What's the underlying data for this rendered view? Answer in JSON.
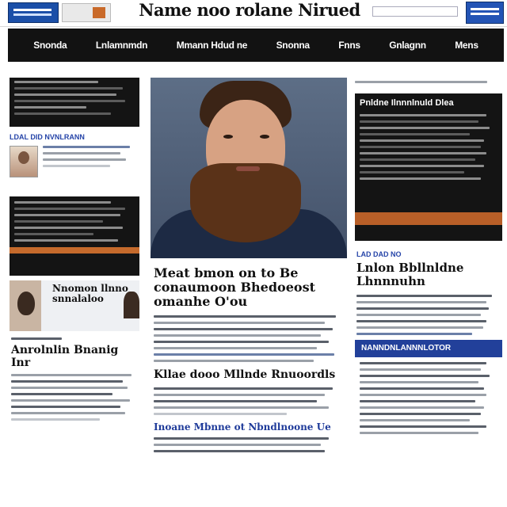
{
  "masthead": {
    "title": "Name noo rolane Nirued",
    "search_placeholder": "",
    "sub": "",
    "icons": {
      "logo": "brand-logo-icon",
      "promo": "promo-thumbnail",
      "badge": "blue-badge-icon"
    }
  },
  "nav": {
    "items": [
      "Snonda",
      "Lnlamnmdn",
      "Mmann Hdud ne",
      "Snonna",
      "Fnns",
      "Gnlagnn",
      "Mens"
    ]
  },
  "left": {
    "section2_label": "LDAL DID NVNLRANN",
    "story_title": "Nnomon llnno snnalaloo",
    "section5_label": "Anrolnlin Bnanig Inr"
  },
  "main": {
    "headline": "Meat bmon on to Be conaumoon Bhedoeost omanhe O'ou",
    "subhead": "Kllae dooo Mllnde Rnuoordls",
    "subhead2": "Inoane Mbnne ot Nbndlnoone Ue"
  },
  "right": {
    "top_label": "",
    "feature_title": "Pnldne Ilnnnlnuld Dlea",
    "section_label": "LAD DAD NO",
    "story_title": "Lnlon Bbllnldne Lhnnnuhn",
    "blue_header": "NANNDNLANNNLOTOR"
  },
  "colors": {
    "nav_bg": "#121212",
    "accent_blue": "#22409a",
    "accent_orange": "#c56a2c"
  }
}
